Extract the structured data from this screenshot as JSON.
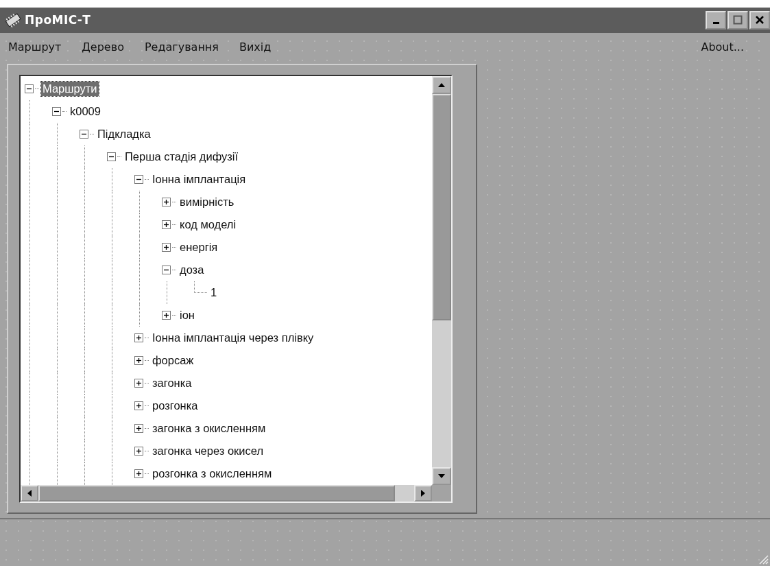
{
  "window": {
    "title": "ПроМІС-Т"
  },
  "menu": [
    {
      "label": "Маршрут"
    },
    {
      "label": "Дерево"
    },
    {
      "label": "Редагування"
    },
    {
      "label": "Вихід"
    }
  ],
  "menu_right": {
    "label": "About..."
  },
  "tree": [
    {
      "label": "Маршрути",
      "expanded": true,
      "selected": true,
      "children": [
        {
          "label": "k0009",
          "expanded": true,
          "selected": false,
          "children": [
            {
              "label": "Підкладка",
              "expanded": true,
              "selected": false,
              "children": [
                {
                  "label": "Перша стадія дифузії",
                  "expanded": true,
                  "selected": false,
                  "children": [
                    {
                      "label": "Іонна імплантація",
                      "expanded": true,
                      "selected": false,
                      "children": [
                        {
                          "label": "вимірність",
                          "expanded": false,
                          "selected": false
                        },
                        {
                          "label": "код моделі",
                          "expanded": false,
                          "selected": false
                        },
                        {
                          "label": "енергія",
                          "expanded": false,
                          "selected": false
                        },
                        {
                          "label": "доза",
                          "expanded": true,
                          "selected": false,
                          "children": [
                            {
                              "label": "1",
                              "selected": false
                            }
                          ]
                        },
                        {
                          "label": "іон",
                          "expanded": false,
                          "selected": false
                        }
                      ]
                    },
                    {
                      "label": "Іонна імплантація через плівку",
                      "expanded": false,
                      "selected": false
                    },
                    {
                      "label": "форсаж",
                      "expanded": false,
                      "selected": false
                    },
                    {
                      "label": "загонка",
                      "expanded": false,
                      "selected": false
                    },
                    {
                      "label": "розгонка",
                      "expanded": false,
                      "selected": false
                    },
                    {
                      "label": "загонка з окисленням",
                      "expanded": false,
                      "selected": false
                    },
                    {
                      "label": "загонка через окисел",
                      "expanded": false,
                      "selected": false
                    },
                    {
                      "label": "розгонка з окисленням",
                      "expanded": false,
                      "selected": false
                    }
                  ]
                }
              ]
            }
          ]
        }
      ]
    }
  ]
}
